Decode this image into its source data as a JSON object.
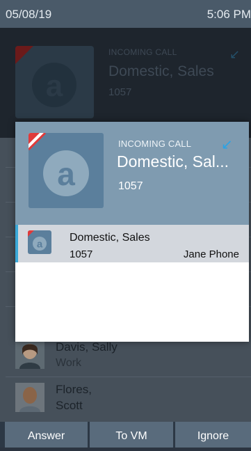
{
  "status_bar": {
    "date": "05/08/19",
    "time": "5:06 PM"
  },
  "background_call": {
    "label": "INCOMING CALL",
    "name": "Domestic, Sales",
    "extension": "1057"
  },
  "background_list": [
    {
      "name_line1": "Davis, Sally",
      "sub": "Work"
    },
    {
      "name_line1": "Flores,",
      "name_line2": "Scott"
    }
  ],
  "popup": {
    "label": "INCOMING CALL",
    "name": "Domestic, Sal...",
    "extension": "1057",
    "row": {
      "name": "Domestic, Sales",
      "extension": "1057",
      "device": "Jane Phone"
    }
  },
  "softkeys": {
    "answer": "Answer",
    "to_vm": "To VM",
    "ignore": "Ignore"
  },
  "colors": {
    "accent": "#3aa8d8",
    "missed_flag": "#e03a3a",
    "header_blue": "#7f9bb0"
  },
  "icons": [
    "incoming-call-arrow-icon",
    "avatar-logo-icon"
  ]
}
